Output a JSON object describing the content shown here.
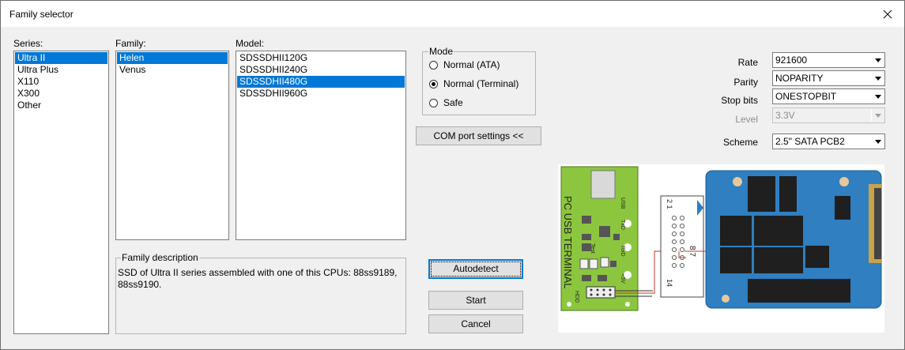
{
  "window": {
    "title": "Family selector"
  },
  "series": {
    "label": "Series:",
    "items": [
      "Ultra II",
      "Ultra Plus",
      "X110",
      "X300",
      "Other"
    ],
    "selected": 0
  },
  "family": {
    "label": "Family:",
    "items": [
      "Helen",
      "Venus"
    ],
    "selected": 0
  },
  "model": {
    "label": "Model:",
    "items": [
      "SDSSDHII120G",
      "SDSSDHII240G",
      "SDSSDHII480G",
      "SDSSDHII960G"
    ],
    "selected": 2
  },
  "mode": {
    "label": "Mode",
    "options": [
      "Normal (ATA)",
      "Normal (Terminal)",
      "Safe"
    ],
    "selected": 1
  },
  "buttons": {
    "com_port": "COM port settings <<",
    "autodetect": "Autodetect",
    "start": "Start",
    "cancel": "Cancel"
  },
  "description": {
    "label": "Family description",
    "text": "SSD of Ultra II series assembled with one of this CPUs: 88ss9189, 88ss9190."
  },
  "settings": {
    "rate": {
      "label": "Rate",
      "value": "921600"
    },
    "parity": {
      "label": "Parity",
      "value": "NOPARITY"
    },
    "stop_bits": {
      "label": "Stop bits",
      "value": "ONESTOPBIT"
    },
    "level": {
      "label": "Level",
      "value": "3.3V"
    },
    "scheme": {
      "label": "Scheme",
      "value": "2.5\" SATA PCB2"
    }
  },
  "diagram": {
    "terminal_label": "PC USB TERMINAL",
    "pins": [
      "USB",
      "TxD",
      "RxD",
      "+5V",
      "Test",
      "HDD"
    ],
    "connector_top": "2 1",
    "connector_bottom": "14",
    "connector_side": "8 7",
    "colors": {
      "board_green": "#8cc63f",
      "pcb_blue": "#2f7fc1",
      "wire_red": "#c0392b"
    }
  }
}
